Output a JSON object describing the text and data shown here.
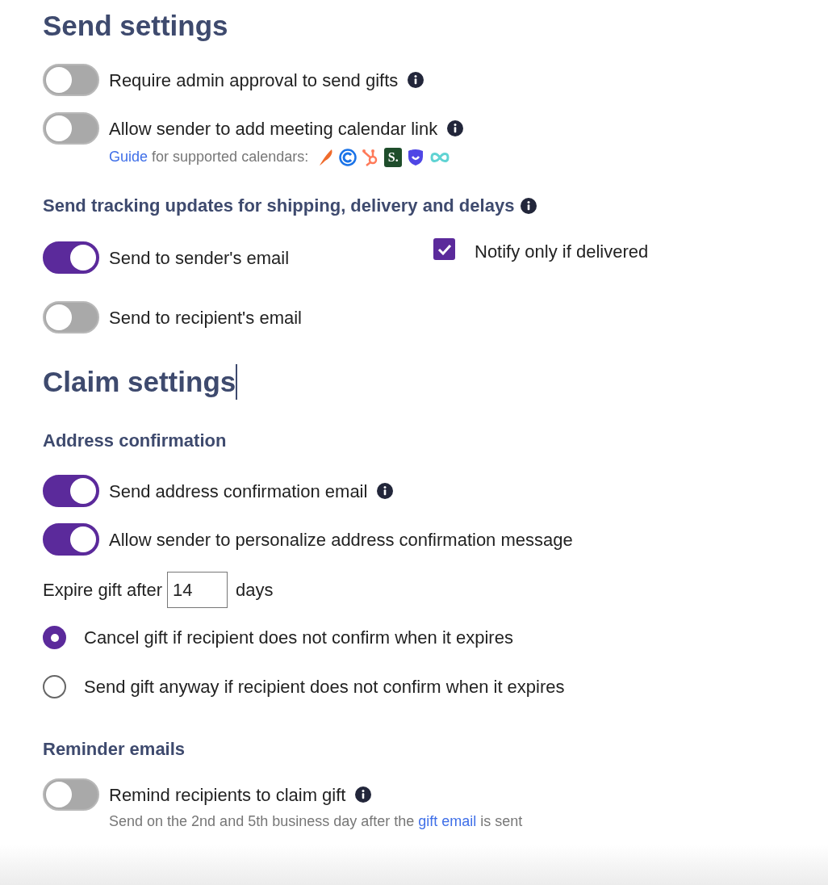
{
  "send_settings": {
    "title": "Send settings",
    "toggles": [
      {
        "label": "Require admin approval to send gifts",
        "on": false,
        "info": true
      },
      {
        "label": "Allow sender to add meeting calendar link",
        "on": false,
        "info": true
      }
    ],
    "guide": {
      "link": "Guide",
      "text": "for supported calendars:",
      "badge": "S."
    },
    "tracking": {
      "heading": "Send tracking updates for shipping, delivery and delays",
      "info": true,
      "toggles": [
        {
          "label": "Send to sender's email",
          "on": true
        },
        {
          "label": "Send to recipient's email",
          "on": false
        }
      ],
      "checkbox": {
        "label": "Notify only if delivered",
        "checked": true
      }
    }
  },
  "claim_settings": {
    "title": "Claim settings",
    "address": {
      "heading": "Address confirmation",
      "toggles": [
        {
          "label": "Send address confirmation email",
          "on": true,
          "info": true
        },
        {
          "label": "Allow sender to personalize address confirmation message",
          "on": true,
          "info": false
        }
      ]
    },
    "expire": {
      "prefix": "Expire gift after",
      "value": "14",
      "suffix": "days"
    },
    "radios": [
      {
        "label": "Cancel gift if recipient does not confirm when it expires",
        "selected": true
      },
      {
        "label": "Send gift anyway if recipient does not confirm when it expires",
        "selected": false
      }
    ],
    "reminder": {
      "heading": "Reminder emails",
      "toggle": {
        "label": "Remind recipients to claim gift",
        "on": false,
        "info": true
      },
      "note": {
        "before": "Send on the 2nd and 5th business day after the",
        "link": "gift email",
        "after": "is sent"
      }
    }
  }
}
